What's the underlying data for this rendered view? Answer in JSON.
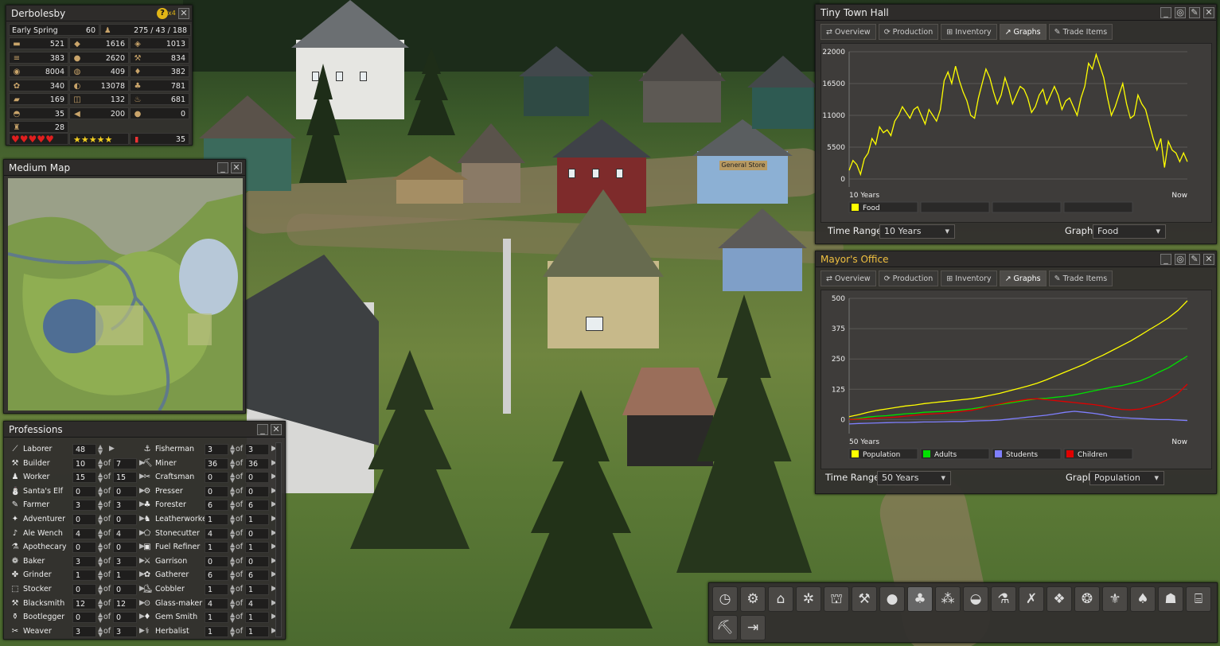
{
  "town": {
    "name": "Derbolesby",
    "season": "Early Spring",
    "season_val": "60",
    "pop": "275 / 43 / 188",
    "x4": "x4",
    "res": [
      [
        "521",
        "1616",
        "1013"
      ],
      [
        "383",
        "2620",
        "834"
      ],
      [
        "8004",
        "409",
        "382"
      ],
      [
        "340",
        "13078",
        "781"
      ],
      [
        "169",
        "132",
        "681"
      ],
      [
        "35",
        "200",
        "0"
      ],
      [
        "28"
      ]
    ],
    "res_icons": [
      [
        "log-icon",
        "stone-icon",
        "iron-icon"
      ],
      [
        "firewood-icon",
        "coal-icon",
        "tool-icon"
      ],
      [
        "food-icon",
        "leather-icon",
        "clothes-icon"
      ],
      [
        "wool-icon",
        "hide-icon",
        "herb-icon"
      ],
      [
        "fuel-icon",
        "flour-icon",
        "fire-icon"
      ],
      [
        "pot-icon",
        "fish-icon",
        "gold-icon"
      ],
      [
        "bootle-icon"
      ]
    ],
    "health_hearts": 5,
    "happiness_stars": 5,
    "temp": "35"
  },
  "minimap": {
    "title": "Medium Map"
  },
  "professions": {
    "title": "Professions",
    "of": "of",
    "left": [
      {
        "name": "Laborer",
        "v": "48",
        "m": ""
      },
      {
        "name": "Builder",
        "v": "10",
        "m": "7"
      },
      {
        "name": "Worker",
        "v": "15",
        "m": "15"
      },
      {
        "name": "Santa's Elf",
        "v": "0",
        "m": "0"
      },
      {
        "name": "Farmer",
        "v": "3",
        "m": "3"
      },
      {
        "name": "Adventurer",
        "v": "0",
        "m": "0"
      },
      {
        "name": "Ale Wench",
        "v": "4",
        "m": "4"
      },
      {
        "name": "Apothecary",
        "v": "0",
        "m": "0"
      },
      {
        "name": "Baker",
        "v": "3",
        "m": "3"
      },
      {
        "name": "Grinder",
        "v": "1",
        "m": "1"
      },
      {
        "name": "Stocker",
        "v": "0",
        "m": "0"
      },
      {
        "name": "Blacksmith",
        "v": "12",
        "m": "12"
      },
      {
        "name": "Bootlegger",
        "v": "0",
        "m": "0"
      },
      {
        "name": "Weaver",
        "v": "3",
        "m": "3"
      }
    ],
    "right": [
      {
        "name": "Fisherman",
        "v": "3",
        "m": "3"
      },
      {
        "name": "Miner",
        "v": "36",
        "m": "36"
      },
      {
        "name": "Craftsman",
        "v": "0",
        "m": "0"
      },
      {
        "name": "Presser",
        "v": "0",
        "m": "0"
      },
      {
        "name": "Forester",
        "v": "6",
        "m": "6"
      },
      {
        "name": "Leatherworker",
        "v": "1",
        "m": "1"
      },
      {
        "name": "Stonecutter",
        "v": "4",
        "m": "0"
      },
      {
        "name": "Fuel Refiner",
        "v": "1",
        "m": "1"
      },
      {
        "name": "Garrison",
        "v": "0",
        "m": "0"
      },
      {
        "name": "Gatherer",
        "v": "6",
        "m": "6"
      },
      {
        "name": "Cobbler",
        "v": "1",
        "m": "1"
      },
      {
        "name": "Glass-maker",
        "v": "4",
        "m": "4"
      },
      {
        "name": "Gem Smith",
        "v": "1",
        "m": "1"
      },
      {
        "name": "Herbalist",
        "v": "1",
        "m": "1"
      }
    ]
  },
  "tabs": [
    "Overview",
    "Production",
    "Inventory",
    "Graphs",
    "Trade Items"
  ],
  "hall": {
    "title": "Tiny Town Hall",
    "time_range_label": "Time Range",
    "time_range": "10 Years",
    "graph_label": "Graph",
    "graph": "Food"
  },
  "mayor": {
    "title": "Mayor's Office",
    "time_range_label": "Time Range",
    "time_range": "50 Years",
    "graph_label": "Graph",
    "graph": "Population"
  },
  "colors": {
    "food": "#ffff00",
    "population": "#ffff00",
    "adults": "#00e000",
    "students": "#7f7fff",
    "children": "#e00000"
  },
  "chart_data": [
    {
      "type": "line",
      "title": "",
      "yticks": [
        "22000",
        "16500",
        "11000",
        "5500",
        "0"
      ],
      "ylim": [
        0,
        22000
      ],
      "x_start": "10 Years",
      "x_end": "Now",
      "series": [
        {
          "name": "Food",
          "values": [
            1500,
            3200,
            2500,
            800,
            3500,
            4500,
            7000,
            6000,
            9000,
            8000,
            8500,
            7500,
            10000,
            11000,
            12500,
            11500,
            10500,
            12000,
            12500,
            11000,
            9500,
            12000,
            11000,
            10000,
            12000,
            17000,
            18500,
            16500,
            19500,
            17000,
            15000,
            13500,
            11000,
            10500,
            14000,
            16500,
            19000,
            17500,
            15000,
            13000,
            14500,
            17500,
            15500,
            13000,
            14500,
            16000,
            15500,
            14000,
            11500,
            12500,
            14500,
            15500,
            13000,
            14500,
            16000,
            14500,
            12000,
            13500,
            14000,
            12500,
            11000,
            14000,
            16000,
            20000,
            19000,
            21500,
            19500,
            17500,
            14000,
            11000,
            12500,
            14500,
            16500,
            13000,
            10500,
            11000,
            14500,
            13000,
            12000,
            9500,
            7000,
            5000,
            7000,
            2000,
            6500,
            5000,
            4500,
            3000,
            4500,
            3000
          ]
        }
      ]
    },
    {
      "type": "line",
      "title": "",
      "yticks": [
        "500",
        "375",
        "250",
        "125",
        "0"
      ],
      "ylim": [
        -25,
        500
      ],
      "x_start": "50 Years",
      "x_end": "Now",
      "series": [
        {
          "name": "Population",
          "values": [
            12,
            20,
            30,
            38,
            44,
            50,
            56,
            60,
            66,
            70,
            74,
            78,
            82,
            86,
            92,
            100,
            108,
            118,
            128,
            138,
            150,
            164,
            180,
            196,
            212,
            228,
            248,
            265,
            285,
            305,
            325,
            348,
            372,
            395,
            420,
            450,
            490
          ]
        },
        {
          "name": "Adults",
          "values": [
            0,
            5,
            10,
            14,
            16,
            20,
            24,
            26,
            30,
            32,
            34,
            36,
            40,
            44,
            50,
            56,
            62,
            68,
            74,
            80,
            86,
            88,
            92,
            96,
            102,
            110,
            118,
            126,
            134,
            140,
            150,
            160,
            176,
            196,
            214,
            238,
            262
          ]
        },
        {
          "name": "Students",
          "values": [
            -18,
            -16,
            -15,
            -14,
            -13,
            -12,
            -12,
            -11,
            -10,
            -10,
            -9,
            -8,
            -8,
            -6,
            -5,
            -4,
            -2,
            2,
            6,
            10,
            14,
            18,
            24,
            30,
            34,
            30,
            26,
            20,
            12,
            8,
            6,
            4,
            2,
            0,
            0,
            -2,
            -4
          ]
        },
        {
          "name": "Children",
          "values": [
            0,
            2,
            4,
            6,
            8,
            10,
            14,
            18,
            22,
            24,
            26,
            30,
            34,
            38,
            46,
            56,
            64,
            72,
            78,
            84,
            86,
            82,
            78,
            74,
            70,
            66,
            62,
            56,
            48,
            42,
            40,
            44,
            54,
            66,
            84,
            108,
            146
          ]
        }
      ]
    }
  ]
}
